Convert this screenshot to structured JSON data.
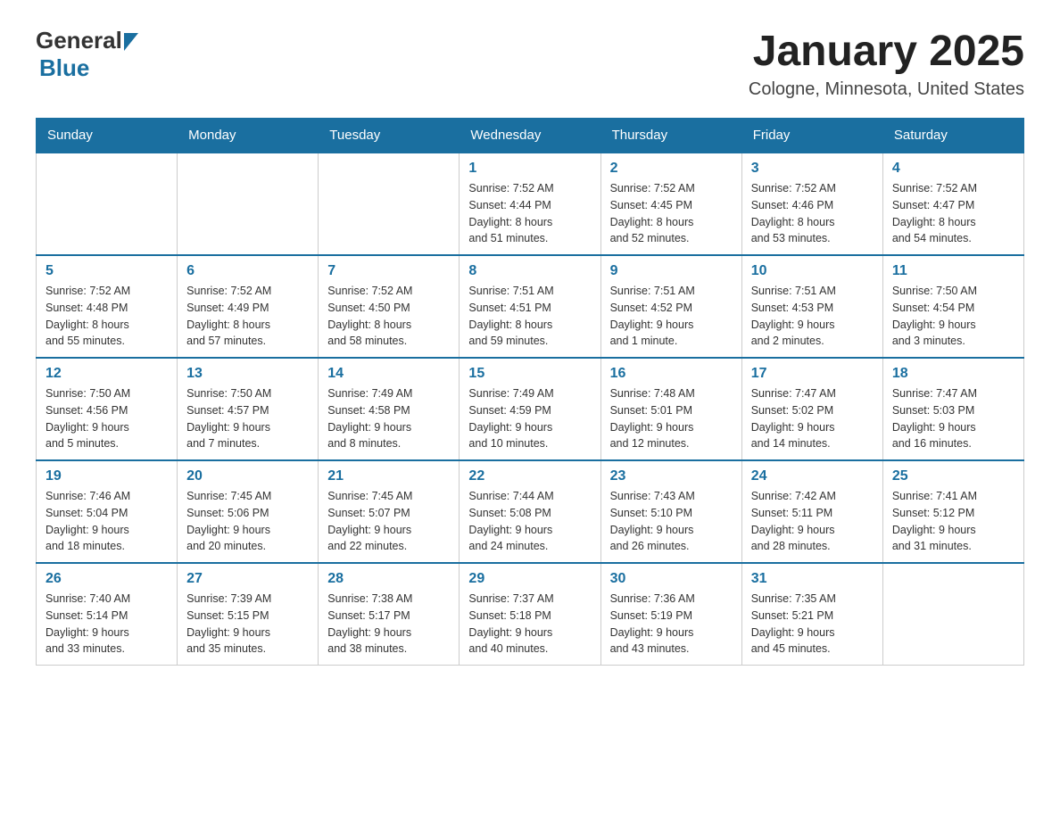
{
  "header": {
    "logo_general": "General",
    "logo_blue": "Blue",
    "title": "January 2025",
    "subtitle": "Cologne, Minnesota, United States"
  },
  "days_of_week": [
    "Sunday",
    "Monday",
    "Tuesday",
    "Wednesday",
    "Thursday",
    "Friday",
    "Saturday"
  ],
  "weeks": [
    {
      "days": [
        {
          "number": "",
          "info": ""
        },
        {
          "number": "",
          "info": ""
        },
        {
          "number": "",
          "info": ""
        },
        {
          "number": "1",
          "info": "Sunrise: 7:52 AM\nSunset: 4:44 PM\nDaylight: 8 hours\nand 51 minutes."
        },
        {
          "number": "2",
          "info": "Sunrise: 7:52 AM\nSunset: 4:45 PM\nDaylight: 8 hours\nand 52 minutes."
        },
        {
          "number": "3",
          "info": "Sunrise: 7:52 AM\nSunset: 4:46 PM\nDaylight: 8 hours\nand 53 minutes."
        },
        {
          "number": "4",
          "info": "Sunrise: 7:52 AM\nSunset: 4:47 PM\nDaylight: 8 hours\nand 54 minutes."
        }
      ]
    },
    {
      "days": [
        {
          "number": "5",
          "info": "Sunrise: 7:52 AM\nSunset: 4:48 PM\nDaylight: 8 hours\nand 55 minutes."
        },
        {
          "number": "6",
          "info": "Sunrise: 7:52 AM\nSunset: 4:49 PM\nDaylight: 8 hours\nand 57 minutes."
        },
        {
          "number": "7",
          "info": "Sunrise: 7:52 AM\nSunset: 4:50 PM\nDaylight: 8 hours\nand 58 minutes."
        },
        {
          "number": "8",
          "info": "Sunrise: 7:51 AM\nSunset: 4:51 PM\nDaylight: 8 hours\nand 59 minutes."
        },
        {
          "number": "9",
          "info": "Sunrise: 7:51 AM\nSunset: 4:52 PM\nDaylight: 9 hours\nand 1 minute."
        },
        {
          "number": "10",
          "info": "Sunrise: 7:51 AM\nSunset: 4:53 PM\nDaylight: 9 hours\nand 2 minutes."
        },
        {
          "number": "11",
          "info": "Sunrise: 7:50 AM\nSunset: 4:54 PM\nDaylight: 9 hours\nand 3 minutes."
        }
      ]
    },
    {
      "days": [
        {
          "number": "12",
          "info": "Sunrise: 7:50 AM\nSunset: 4:56 PM\nDaylight: 9 hours\nand 5 minutes."
        },
        {
          "number": "13",
          "info": "Sunrise: 7:50 AM\nSunset: 4:57 PM\nDaylight: 9 hours\nand 7 minutes."
        },
        {
          "number": "14",
          "info": "Sunrise: 7:49 AM\nSunset: 4:58 PM\nDaylight: 9 hours\nand 8 minutes."
        },
        {
          "number": "15",
          "info": "Sunrise: 7:49 AM\nSunset: 4:59 PM\nDaylight: 9 hours\nand 10 minutes."
        },
        {
          "number": "16",
          "info": "Sunrise: 7:48 AM\nSunset: 5:01 PM\nDaylight: 9 hours\nand 12 minutes."
        },
        {
          "number": "17",
          "info": "Sunrise: 7:47 AM\nSunset: 5:02 PM\nDaylight: 9 hours\nand 14 minutes."
        },
        {
          "number": "18",
          "info": "Sunrise: 7:47 AM\nSunset: 5:03 PM\nDaylight: 9 hours\nand 16 minutes."
        }
      ]
    },
    {
      "days": [
        {
          "number": "19",
          "info": "Sunrise: 7:46 AM\nSunset: 5:04 PM\nDaylight: 9 hours\nand 18 minutes."
        },
        {
          "number": "20",
          "info": "Sunrise: 7:45 AM\nSunset: 5:06 PM\nDaylight: 9 hours\nand 20 minutes."
        },
        {
          "number": "21",
          "info": "Sunrise: 7:45 AM\nSunset: 5:07 PM\nDaylight: 9 hours\nand 22 minutes."
        },
        {
          "number": "22",
          "info": "Sunrise: 7:44 AM\nSunset: 5:08 PM\nDaylight: 9 hours\nand 24 minutes."
        },
        {
          "number": "23",
          "info": "Sunrise: 7:43 AM\nSunset: 5:10 PM\nDaylight: 9 hours\nand 26 minutes."
        },
        {
          "number": "24",
          "info": "Sunrise: 7:42 AM\nSunset: 5:11 PM\nDaylight: 9 hours\nand 28 minutes."
        },
        {
          "number": "25",
          "info": "Sunrise: 7:41 AM\nSunset: 5:12 PM\nDaylight: 9 hours\nand 31 minutes."
        }
      ]
    },
    {
      "days": [
        {
          "number": "26",
          "info": "Sunrise: 7:40 AM\nSunset: 5:14 PM\nDaylight: 9 hours\nand 33 minutes."
        },
        {
          "number": "27",
          "info": "Sunrise: 7:39 AM\nSunset: 5:15 PM\nDaylight: 9 hours\nand 35 minutes."
        },
        {
          "number": "28",
          "info": "Sunrise: 7:38 AM\nSunset: 5:17 PM\nDaylight: 9 hours\nand 38 minutes."
        },
        {
          "number": "29",
          "info": "Sunrise: 7:37 AM\nSunset: 5:18 PM\nDaylight: 9 hours\nand 40 minutes."
        },
        {
          "number": "30",
          "info": "Sunrise: 7:36 AM\nSunset: 5:19 PM\nDaylight: 9 hours\nand 43 minutes."
        },
        {
          "number": "31",
          "info": "Sunrise: 7:35 AM\nSunset: 5:21 PM\nDaylight: 9 hours\nand 45 minutes."
        },
        {
          "number": "",
          "info": ""
        }
      ]
    }
  ]
}
